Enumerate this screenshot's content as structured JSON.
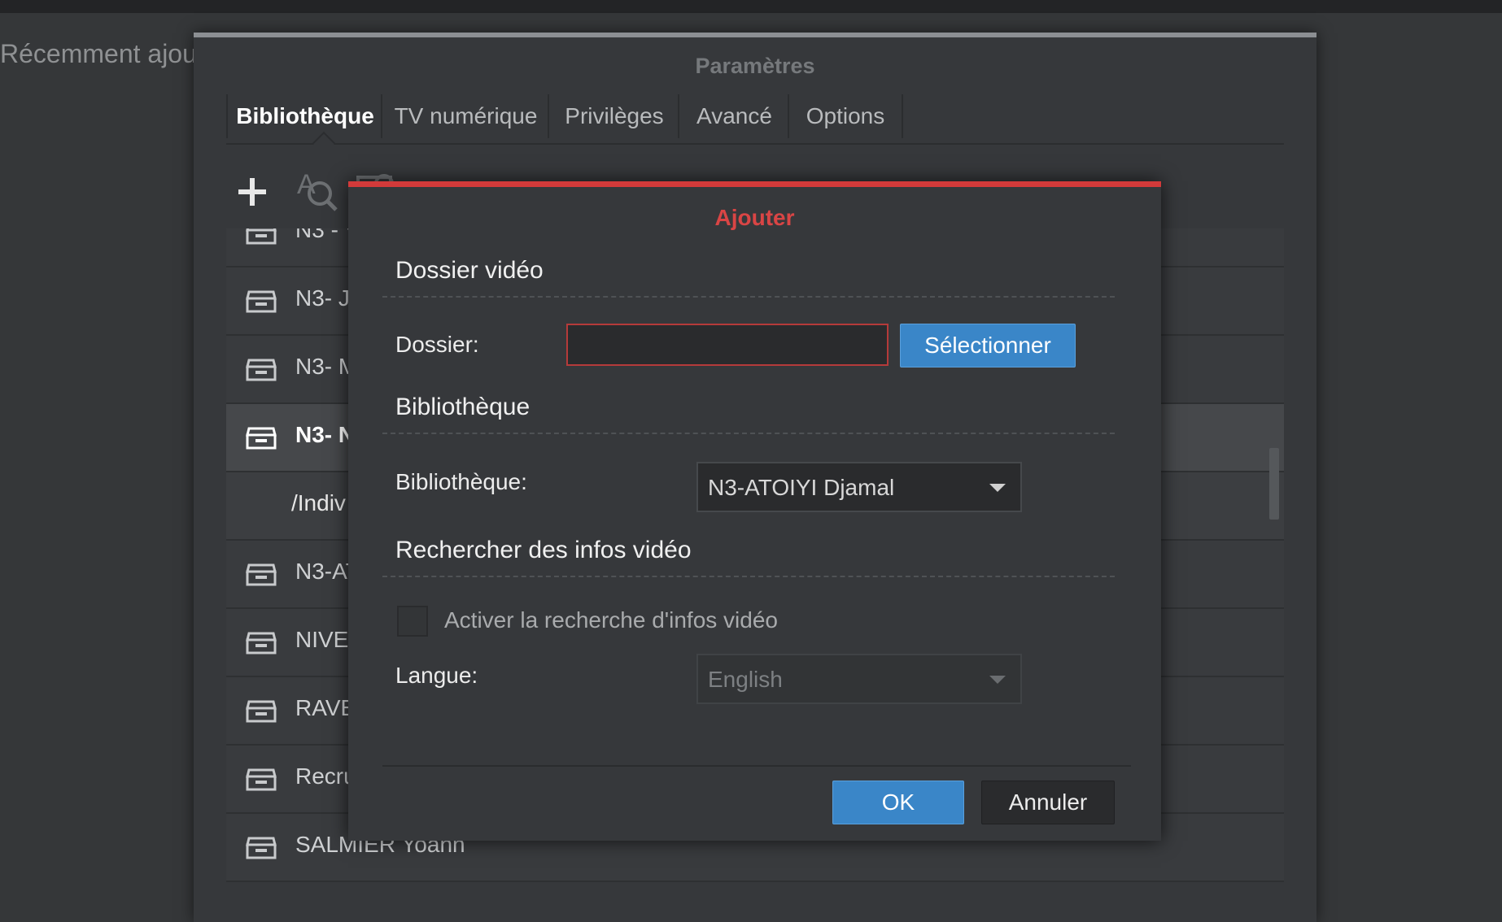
{
  "background": {
    "title": "Récemment ajou"
  },
  "settings": {
    "title": "Paramètres",
    "tabs": [
      {
        "label": "Bibliothèque"
      },
      {
        "label": "TV numérique"
      },
      {
        "label": "Privilèges"
      },
      {
        "label": "Avancé"
      },
      {
        "label": "Options"
      }
    ],
    "toolbar": {
      "add_icon": "plus-icon",
      "search_icon": "text-search-icon",
      "folder_icon": "settings-folder-icon"
    },
    "list": [
      {
        "label": "N3 - V",
        "icon": "drawer-icon"
      },
      {
        "label": "N3- J",
        "icon": "drawer-icon"
      },
      {
        "label": "N3- M",
        "icon": "drawer-icon"
      },
      {
        "label": "N3- N",
        "icon": "drawer-icon",
        "selected": true
      },
      {
        "label": "/Indiv",
        "sub": true
      },
      {
        "label": "N3-AT",
        "icon": "drawer-icon"
      },
      {
        "label": "NIVE",
        "icon": "drawer-icon"
      },
      {
        "label": "RAVE",
        "icon": "drawer-icon"
      },
      {
        "label": "Recru",
        "icon": "drawer-icon"
      },
      {
        "label": "SALMIER Yoann",
        "icon": "drawer-icon"
      }
    ]
  },
  "dialog": {
    "title": "Ajouter",
    "accent_color": "#d33a3a",
    "video_folder": {
      "heading": "Dossier vidéo",
      "folder_label": "Dossier:",
      "folder_value": "",
      "select_button": "Sélectionner"
    },
    "library": {
      "heading": "Bibliothèque",
      "label": "Bibliothèque:",
      "selected": "N3-ATOIYI Djamal"
    },
    "search_info": {
      "heading": "Rechercher des infos vidéo",
      "checkbox_label": "Activer la recherche d'infos vidéo",
      "checked": false,
      "language_label": "Langue:",
      "language_value": "English"
    },
    "buttons": {
      "ok": "OK",
      "cancel": "Annuler"
    }
  }
}
